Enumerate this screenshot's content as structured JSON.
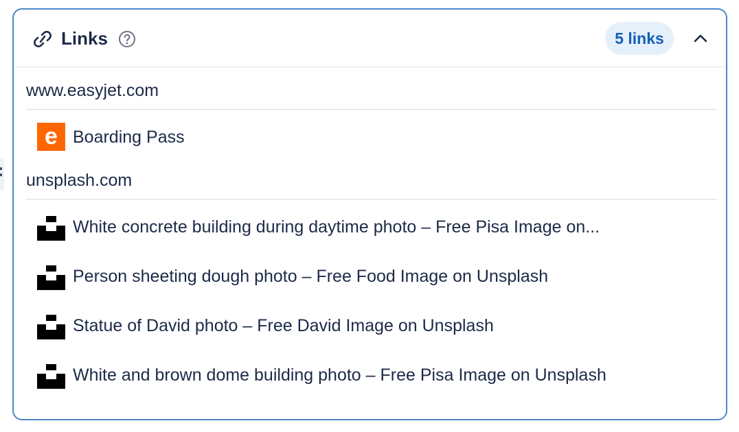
{
  "header": {
    "title": "Links",
    "count_badge": "5 links",
    "icons": {
      "links": "link-icon",
      "help": "help-icon",
      "collapse": "chevron-up-icon"
    }
  },
  "groups": [
    {
      "domain": "www.easyjet.com",
      "favicon": "easyjet-logo-icon",
      "items": [
        {
          "title": "Boarding Pass"
        }
      ]
    },
    {
      "domain": "unsplash.com",
      "favicon": "unsplash-logo-icon",
      "items": [
        {
          "title": "White concrete building during daytime photo – Free Pisa Image on..."
        },
        {
          "title": "Person sheeting dough photo – Free Food Image on Unsplash"
        },
        {
          "title": "Statue of David photo – Free David Image on Unsplash"
        },
        {
          "title": "White and brown dome building photo – Free Pisa Image on Unsplash"
        }
      ]
    }
  ],
  "colors": {
    "panel_border": "#4e87c9",
    "badge_bg": "#e6f0fb",
    "badge_text": "#1261b5",
    "easyjet_orange": "#ff6600",
    "text": "#1c2a48"
  }
}
